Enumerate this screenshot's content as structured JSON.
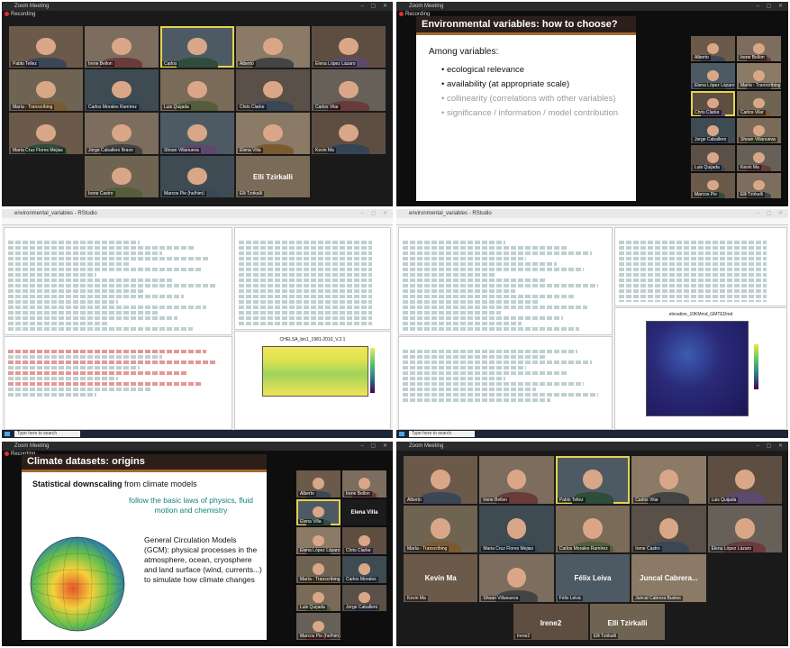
{
  "window_title": "Zoom Meeting",
  "recording_label": "Recording",
  "taskbar_search": "Type here to search",
  "panel1": {
    "participants": [
      {
        "name": "Pablo Tellez"
      },
      {
        "name": "Irene Bellon"
      },
      {
        "name": "Carlos"
      },
      {
        "name": "Alberto"
      },
      {
        "name": "Elena López Lázaro"
      },
      {
        "name": "María - Transcribing"
      },
      {
        "name": "Carlos Morales Ramírez"
      },
      {
        "name": "Luis Quijada"
      },
      {
        "name": "Chris Clarke"
      },
      {
        "name": "Carlos Vilar"
      },
      {
        "name": "María Cruz Flores Mejias"
      },
      {
        "name": "Jorge Caballero Bravo"
      },
      {
        "name": "Shoan Villanueva"
      },
      {
        "name": "Elena Villa"
      },
      {
        "name": "Kevin Ma"
      },
      {
        "name": "Irene Castro"
      },
      {
        "name": "Marcos Pie (he/him)"
      },
      {
        "name": "Elli Tzirkalli",
        "label": "Elli Tzirkalli"
      }
    ]
  },
  "panel2": {
    "slide_title": "Environmental variables: how to choose?",
    "intro": "Among variables:",
    "bullets": [
      "ecological relevance",
      "availability (at appropriate scale)"
    ],
    "bullets_gray": [
      "collinearity (correlations with other variables)",
      "significance / information / model contribution"
    ],
    "side_names": [
      "Alberto",
      "Irene Bellon",
      "Elena López Lázaro",
      "María - Transcribing",
      "Chris Clarke",
      "Carlos Vilar",
      "Jorge Caballero",
      "Shoan Villanueva",
      "Luis Quijada",
      "Kevin Ma",
      "Marcos Pie",
      "Elli Tzirkalli"
    ]
  },
  "panel3": {
    "title": "environmental_variables - RStudio",
    "plot_title": "CHELSA_bio1_1981-2010_V.2.1"
  },
  "panel4": {
    "title": "environmental_variables - RStudio",
    "plot_title": "elevation_10KMmd_GMTEDmd"
  },
  "panel5": {
    "slide_title": "Climate datasets: origins",
    "sd_bold": "Statistical downscaling",
    "sd_rest": "from climate models",
    "teal_text": "follow the basic laws of physics, fluid motion and chemistry",
    "gcm_text": "General Circulation Models (GCM): physical processes in the atmosphere, ocean, cryosphere and land surface (wind, currents...) to simulate how climate changes",
    "side_names": [
      "Alberto",
      "Irene Bellon",
      "Elena Villa",
      "Elena López Lázaro",
      "Chris Clarke",
      "María - Transcribing",
      "Carlos Morales",
      "Luis Quijada",
      "Jorge Caballero",
      "Marcos Pie (he/him)"
    ],
    "side_label": "Elena Villa"
  },
  "panel6": {
    "participants": [
      {
        "name": "Alberto"
      },
      {
        "name": "Irene Bellon"
      },
      {
        "name": "Pablo Tellez"
      },
      {
        "name": "Carlos Vilar"
      },
      {
        "name": "Luis Quijada"
      },
      {
        "name": "María - Transcribing"
      },
      {
        "name": "Maria Cruz Flores Mejias"
      },
      {
        "name": "Carlos Morales Ramírez"
      },
      {
        "name": "Irene Castro"
      },
      {
        "name": "Elena López Lázaro"
      },
      {
        "name": "Kevin Ma",
        "label": "Kevin Ma"
      },
      {
        "name": "Shoan Villanueva"
      },
      {
        "name": "Félix Leiva",
        "label": "Félix Leiva"
      },
      {
        "name": "Juncal Cabrera Bustos",
        "label": "Juncal Cabrera..."
      },
      {
        "name": "Irene2",
        "label": "Irene2"
      },
      {
        "name": "Elli Tzirkalli",
        "label": "Elli Tzirkalli"
      }
    ]
  },
  "colors": {
    "slide_header_bg": "#2c1f1a",
    "slide_header_rule": "#a46a2e",
    "teal": "#14827a",
    "active_speaker": "#e3d54a"
  }
}
